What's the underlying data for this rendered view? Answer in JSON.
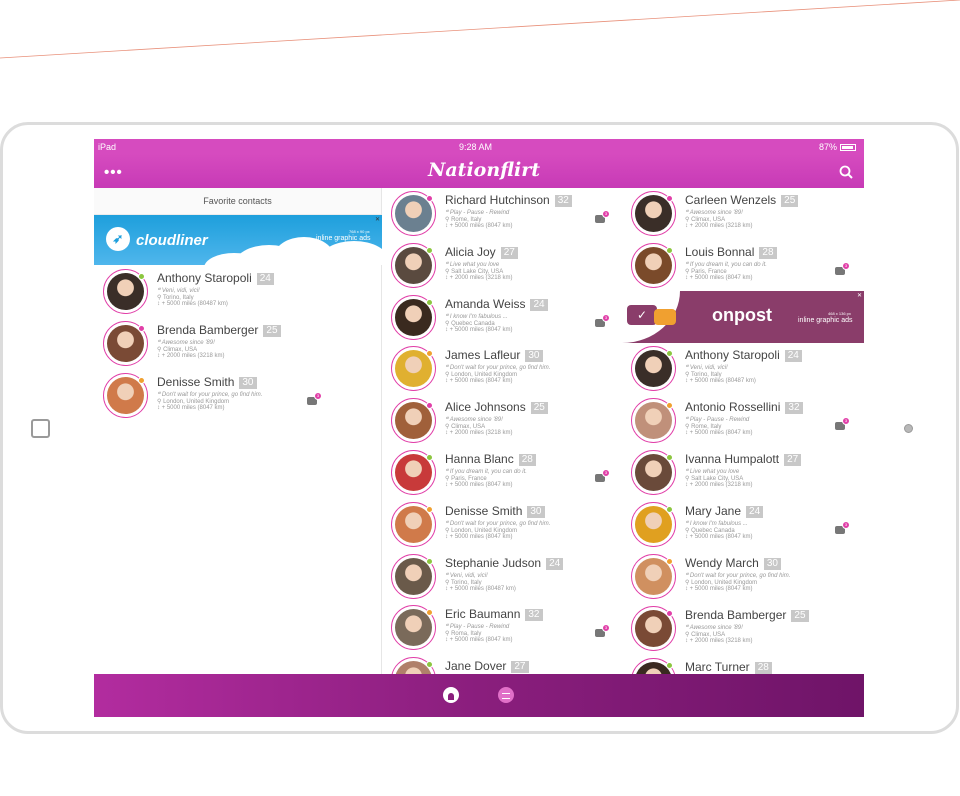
{
  "status_bar": {
    "device": "iPad",
    "time": "9:28 AM",
    "battery": "87%"
  },
  "app": {
    "title": "Nationflirt",
    "menu_icon": "ellipsis-icon",
    "search_icon": "search-icon"
  },
  "sidebar": {
    "header": "Favorite contacts",
    "ad": {
      "brand": "cloudliner",
      "tagline": "inline graphic ads",
      "size": "768 x 90 px"
    },
    "contacts": [
      {
        "name": "Anthony Staropoli",
        "age": "24",
        "quote": "Veni, vidi, vici!",
        "location": "Torino, Italy",
        "distance": "+ 5000 miles (80487 km)",
        "status": "online",
        "color": "#3a2e28",
        "messages": ""
      },
      {
        "name": "Brenda Bamberger",
        "age": "25",
        "quote": "Awesome since '89!",
        "location": "Climax, USA",
        "distance": "+ 2000 miles (3218 km)",
        "status": "busy",
        "color": "#7a4a35",
        "messages": ""
      },
      {
        "name": "Denisse Smith",
        "age": "30",
        "quote": "Don't wait for your prince, go find him.",
        "location": "London, United Kingdom",
        "distance": "+ 5000 miles (8047 km)",
        "status": "away",
        "color": "#d07a4a",
        "messages": "3"
      }
    ]
  },
  "grid": {
    "left_column": [
      {
        "name": "Richard Hutchinson",
        "age": "32",
        "quote": "Play - Pause - Rewind",
        "location": "Rome, Italy",
        "distance": "+ 5000 miles (8047 km)",
        "status": "busy",
        "color": "#6b8090",
        "messages": "3"
      },
      {
        "name": "Alicia Joy",
        "age": "27",
        "quote": "Live what you love",
        "location": "Salt Lake City, USA",
        "distance": "+ 2000 miles (3218 km)",
        "status": "online",
        "color": "#5a4a3f",
        "messages": ""
      },
      {
        "name": "Amanda Weiss",
        "age": "24",
        "quote": "I know I'm fabulous ...",
        "location": "Quebec Canada",
        "distance": "+ 5000 miles (8047 km)",
        "status": "online",
        "color": "#3a2a1f",
        "messages": "3"
      },
      {
        "name": "James Lafleur",
        "age": "30",
        "quote": "Don't wait for your prince, go find him.",
        "location": "London, United Kingdom",
        "distance": "+ 5000 miles (8047 km)",
        "status": "away",
        "color": "#e0b030",
        "messages": ""
      },
      {
        "name": "Alice Johnsons",
        "age": "25",
        "quote": "Awesome since '89!",
        "location": "Climax, USA",
        "distance": "+ 2000 miles (3218 km)",
        "status": "busy",
        "color": "#a0603a",
        "messages": ""
      },
      {
        "name": "Hanna Blanc",
        "age": "28",
        "quote": "If you dream it, you can do it.",
        "location": "Paris, France",
        "distance": "+ 5000 miles (8047 km)",
        "status": "online",
        "color": "#c83a3a",
        "messages": "3"
      },
      {
        "name": "Denisse Smith",
        "age": "30",
        "quote": "Don't wait for your prince, go find him.",
        "location": "London, United Kingdom",
        "distance": "+ 5000 miles (8047 km)",
        "status": "away",
        "color": "#d07a4a",
        "messages": ""
      },
      {
        "name": "Stephanie Judson",
        "age": "24",
        "quote": "Veni, vidi, vici!",
        "location": "Torino, Italy",
        "distance": "+ 5000 miles (80487 km)",
        "status": "online",
        "color": "#6a5a4a",
        "messages": ""
      },
      {
        "name": "Eric Baumann",
        "age": "32",
        "quote": "Play - Pause - Rewind",
        "location": "Roma, Italy",
        "distance": "+ 5000 miles (8047 km)",
        "status": "away",
        "color": "#7a6a5a",
        "messages": "3"
      },
      {
        "name": "Jane Dover",
        "age": "27",
        "quote": "",
        "location": "",
        "distance": "",
        "status": "online",
        "color": "#b0806a",
        "messages": ""
      }
    ],
    "right_column": [
      {
        "name": "Carleen Wenzels",
        "age": "25",
        "quote": "Awesome since '89!",
        "location": "Climax, USA",
        "distance": "+ 2000 miles (3218 km)",
        "status": "busy",
        "color": "#3a2e28",
        "messages": ""
      },
      {
        "name": "Louis Bonnal",
        "age": "28",
        "quote": "If you dream it, you can do it.",
        "location": "Paris, France",
        "distance": "+ 5000 miles (8047 km)",
        "status": "online",
        "color": "#7a4a2a",
        "messages": "3"
      },
      {
        "name": "Anthony Staropoli",
        "age": "24",
        "quote": "Veni, vidi, vici!",
        "location": "Torino, Italy",
        "distance": "+ 5000 miles (80487 km)",
        "status": "online",
        "color": "#3a2e28",
        "messages": ""
      },
      {
        "name": "Antonio Rossellini",
        "age": "32",
        "quote": "Play - Pause - Rewind",
        "location": "Rome, Italy",
        "distance": "+ 5000 miles (8047 km)",
        "status": "away",
        "color": "#c0907a",
        "messages": "3"
      },
      {
        "name": "Ivanna Humpalott",
        "age": "27",
        "quote": "Live what you love",
        "location": "Salt Lake City, USA",
        "distance": "+ 2000 miles (3218 km)",
        "status": "online",
        "color": "#6a4a3a",
        "messages": ""
      },
      {
        "name": "Mary Jane",
        "age": "24",
        "quote": "I know I'm fabulous ...",
        "location": "Quebec Canada",
        "distance": "+ 5000 miles (8047 km)",
        "status": "online",
        "color": "#e0a020",
        "messages": "3"
      },
      {
        "name": "Wendy March",
        "age": "30",
        "quote": "Don't wait for your prince, go find him.",
        "location": "London, United Kingdom",
        "distance": "+ 5000 miles (8047 km)",
        "status": "away",
        "color": "#d09060",
        "messages": ""
      },
      {
        "name": "Brenda Bamberger",
        "age": "25",
        "quote": "Awesome since '89!",
        "location": "Climax, USA",
        "distance": "+ 2000 miles (3218 km)",
        "status": "busy",
        "color": "#7a4a35",
        "messages": ""
      },
      {
        "name": "Marc Turner",
        "age": "28",
        "quote": "",
        "location": "",
        "distance": "",
        "status": "online",
        "color": "#3a2a20",
        "messages": ""
      }
    ],
    "ad": {
      "brand": "onpost",
      "tagline": "inline graphic ads",
      "size": "468 x 136 px"
    }
  },
  "tab_bar": {
    "home_icon": "home-icon",
    "messages_icon": "messages-icon"
  }
}
